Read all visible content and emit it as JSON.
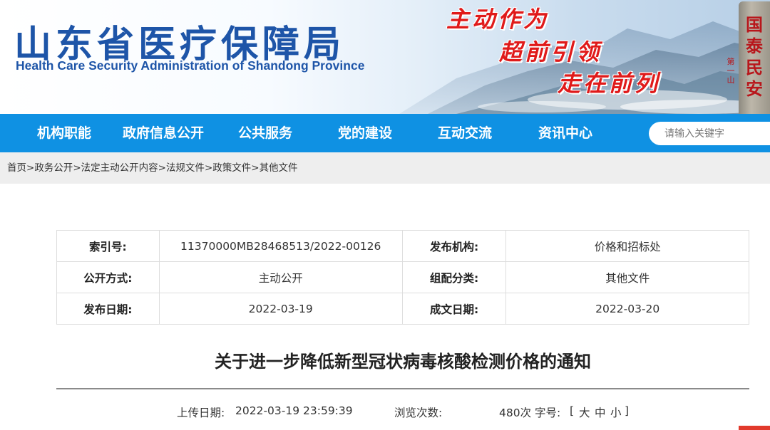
{
  "header": {
    "org_name_cn": "山东省医疗保障局",
    "org_name_en": "Health Care Security Administration of Shandong Province",
    "slogan": [
      "主动作为",
      "超前引领",
      "走在前列"
    ],
    "stele_text": "国泰民安",
    "stele_small_text": "第一山"
  },
  "nav": {
    "items": [
      {
        "label": "机构职能"
      },
      {
        "label": "政府信息公开"
      },
      {
        "label": "公共服务"
      },
      {
        "label": "党的建设"
      },
      {
        "label": "互动交流"
      },
      {
        "label": "资讯中心"
      }
    ],
    "search_placeholder": "请输入关键字"
  },
  "breadcrumb": {
    "items": [
      "首页",
      "政务公开",
      "法定主动公开内容",
      "法规文件",
      "政策文件",
      "其他文件"
    ],
    "separator": ">"
  },
  "info_table": {
    "rows": [
      {
        "label1": "索引号:",
        "value1": "11370000MB28468513/2022-00126",
        "label2": "发布机构:",
        "value2": "价格和招标处"
      },
      {
        "label1": "公开方式:",
        "value1": "主动公开",
        "label2": "组配分类:",
        "value2": "其他文件"
      },
      {
        "label1": "发布日期:",
        "value1": "2022-03-19",
        "label2": "成文日期:",
        "value2": "2022-03-20"
      }
    ]
  },
  "article": {
    "title": "关于进一步降低新型冠状病毒核酸检测价格的通知",
    "upload_label": "上传日期:",
    "upload_value": "2022-03-19 23:59:39",
    "views_label": "浏览次数:",
    "views_value": "480次",
    "font_size_label": "字号:",
    "font_size_open": "[",
    "font_large": "大",
    "font_medium": "中",
    "font_small": "小",
    "font_size_close": "]"
  },
  "colors": {
    "brand_blue": "#1e55a8",
    "nav_blue": "#0f91e3",
    "slogan_red": "#e01a1a"
  }
}
